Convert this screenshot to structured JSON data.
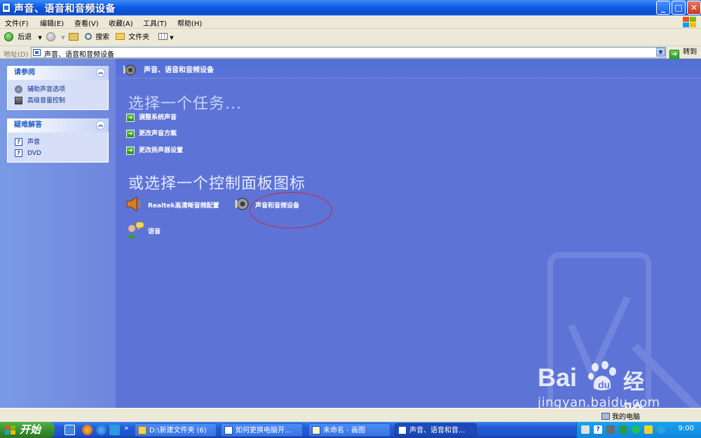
{
  "window": {
    "title": "声音、语音和音频设备",
    "buttons": {
      "minimize": "_",
      "maximize": "□",
      "close": "✕"
    }
  },
  "menu": [
    "文件(F)",
    "编辑(E)",
    "查看(V)",
    "收藏(A)",
    "工具(T)",
    "帮助(H)"
  ],
  "toolbar": {
    "back": "后退",
    "search": "搜索",
    "folders": "文件夹"
  },
  "address": {
    "label": "地址(D)",
    "value": "声音、语音和音频设备",
    "go": "转到"
  },
  "sidebar": {
    "see_also": {
      "title": "请参阅",
      "items": [
        {
          "label": "辅助声音选项",
          "icon": "accessibility-icon"
        },
        {
          "label": "高级音量控制",
          "icon": "volume-icon"
        }
      ]
    },
    "troubleshoot": {
      "title": "疑难解答",
      "items": [
        {
          "label": "声音",
          "icon": "help-icon"
        },
        {
          "label": "DVD",
          "icon": "help-icon"
        }
      ]
    }
  },
  "main": {
    "header": "声音、语音和音频设备",
    "pick_task": "选择一个任务...",
    "tasks": [
      "调整系统声音",
      "更改声音方案",
      "更改扬声器设置"
    ],
    "pick_icon": "或选择一个控制面板图标",
    "icons": [
      {
        "label": "Realtek高清晰音频配置",
        "icon": "speaker-icon"
      },
      {
        "label": "声音和音频设备",
        "icon": "audio-device-icon"
      },
      {
        "label": "语音",
        "icon": "speech-icon"
      }
    ]
  },
  "status": {
    "zone": "我的电脑"
  },
  "watermark": {
    "brand": "Bai",
    "brand_cn": "经验",
    "url": "jingyan.baidu.com"
  },
  "taskbar": {
    "start": "开始",
    "more": "»",
    "buttons": [
      {
        "label": "D:\\新建文件夹 (6)",
        "active": false
      },
      {
        "label": "如何更换电脑开...",
        "active": false
      },
      {
        "label": "未命名 - 画图",
        "active": false
      },
      {
        "label": "声音、语音和音...",
        "active": true
      }
    ],
    "clock": "9:00"
  },
  "colors": {
    "title_bar": "#0a4fd1",
    "main_bg": "#5d73d6",
    "task_arrow": "#3aa82a",
    "annotation_circle": "#c8283e"
  }
}
